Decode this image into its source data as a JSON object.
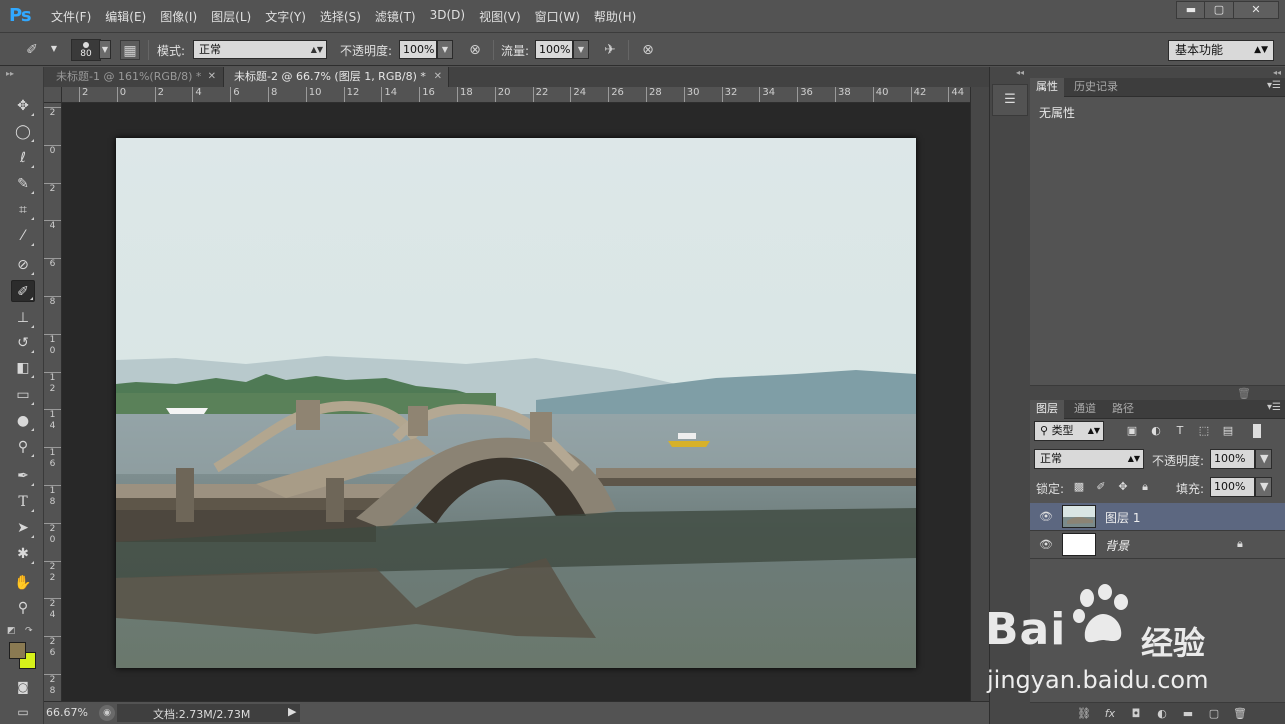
{
  "app": {
    "logo": "Ps"
  },
  "menu": [
    "文件(F)",
    "编辑(E)",
    "图像(I)",
    "图层(L)",
    "文字(Y)",
    "选择(S)",
    "滤镜(T)",
    "3D(D)",
    "视图(V)",
    "窗口(W)",
    "帮助(H)"
  ],
  "window_controls": {
    "minimize": "▬",
    "maximize": "▢",
    "close": "✕"
  },
  "options": {
    "brush_size": "80",
    "mode_label": "模式:",
    "mode_value": "正常",
    "opacity_label": "不透明度:",
    "opacity_value": "100%",
    "flow_label": "流量:",
    "flow_value": "100%",
    "workspace": "基本功能"
  },
  "tabs": [
    {
      "title": "未标题-1 @ 161%(RGB/8) *",
      "active": false
    },
    {
      "title": "未标题-2 @ 66.7% (图层 1, RGB/8) *",
      "active": true
    }
  ],
  "ruler": {
    "h_labels": [
      "2",
      "0",
      "2",
      "4",
      "6",
      "8",
      "10",
      "12",
      "14",
      "16",
      "18",
      "20",
      "22",
      "24",
      "26",
      "28",
      "30",
      "32",
      "34",
      "36",
      "38",
      "40",
      "42",
      "44"
    ],
    "v_labels": [
      "2",
      "0",
      "2",
      "4",
      "6",
      "8",
      "10",
      "12",
      "14",
      "16",
      "18",
      "20",
      "22",
      "24",
      "26",
      "28"
    ]
  },
  "tools": [
    {
      "name": "move-tool",
      "glyph": "✥"
    },
    {
      "name": "elliptical-marquee-tool",
      "glyph": "◯"
    },
    {
      "name": "lasso-tool",
      "glyph": "ℓ"
    },
    {
      "name": "quick-selection-tool",
      "glyph": "✎"
    },
    {
      "name": "crop-tool",
      "glyph": "⌗"
    },
    {
      "name": "eyedropper-tool",
      "glyph": "⁄"
    },
    {
      "name": "spot-healing-tool",
      "glyph": "⊘"
    },
    {
      "name": "brush-tool",
      "glyph": "✐"
    },
    {
      "name": "clone-stamp-tool",
      "glyph": "⊥"
    },
    {
      "name": "history-brush-tool",
      "glyph": "↺"
    },
    {
      "name": "eraser-tool",
      "glyph": "◧"
    },
    {
      "name": "gradient-tool",
      "glyph": "▭"
    },
    {
      "name": "blur-tool",
      "glyph": "●"
    },
    {
      "name": "dodge-tool",
      "glyph": "⚲"
    },
    {
      "name": "pen-tool",
      "glyph": "✒"
    },
    {
      "name": "type-tool",
      "glyph": "T"
    },
    {
      "name": "path-selection-tool",
      "glyph": "➤"
    },
    {
      "name": "custom-shape-tool",
      "glyph": "✱"
    },
    {
      "name": "hand-tool",
      "glyph": "✋"
    },
    {
      "name": "zoom-tool",
      "glyph": "⚲"
    }
  ],
  "colors": {
    "foreground": "#8a7a52",
    "background": "#d7f21a"
  },
  "status": {
    "zoom": "66.67%",
    "docinfo": "文档:2.73M/2.73M"
  },
  "properties": {
    "tab_properties": "属性",
    "tab_history": "历史记录",
    "empty": "无属性"
  },
  "layers": {
    "tab_layers": "图层",
    "tab_channels": "通道",
    "tab_paths": "路径",
    "filter_kind": "类型",
    "blend_mode": "正常",
    "opacity_label": "不透明度:",
    "opacity_value": "100%",
    "lock_label": "锁定:",
    "fill_label": "填充:",
    "fill_value": "100%",
    "items": [
      {
        "name": "图层 1",
        "selected": true
      },
      {
        "name": "背景",
        "selected": false,
        "locked": true
      }
    ]
  },
  "watermark": {
    "brand": "Bai",
    "brand_cn": "经验",
    "url": "jingyan.baidu.com"
  }
}
